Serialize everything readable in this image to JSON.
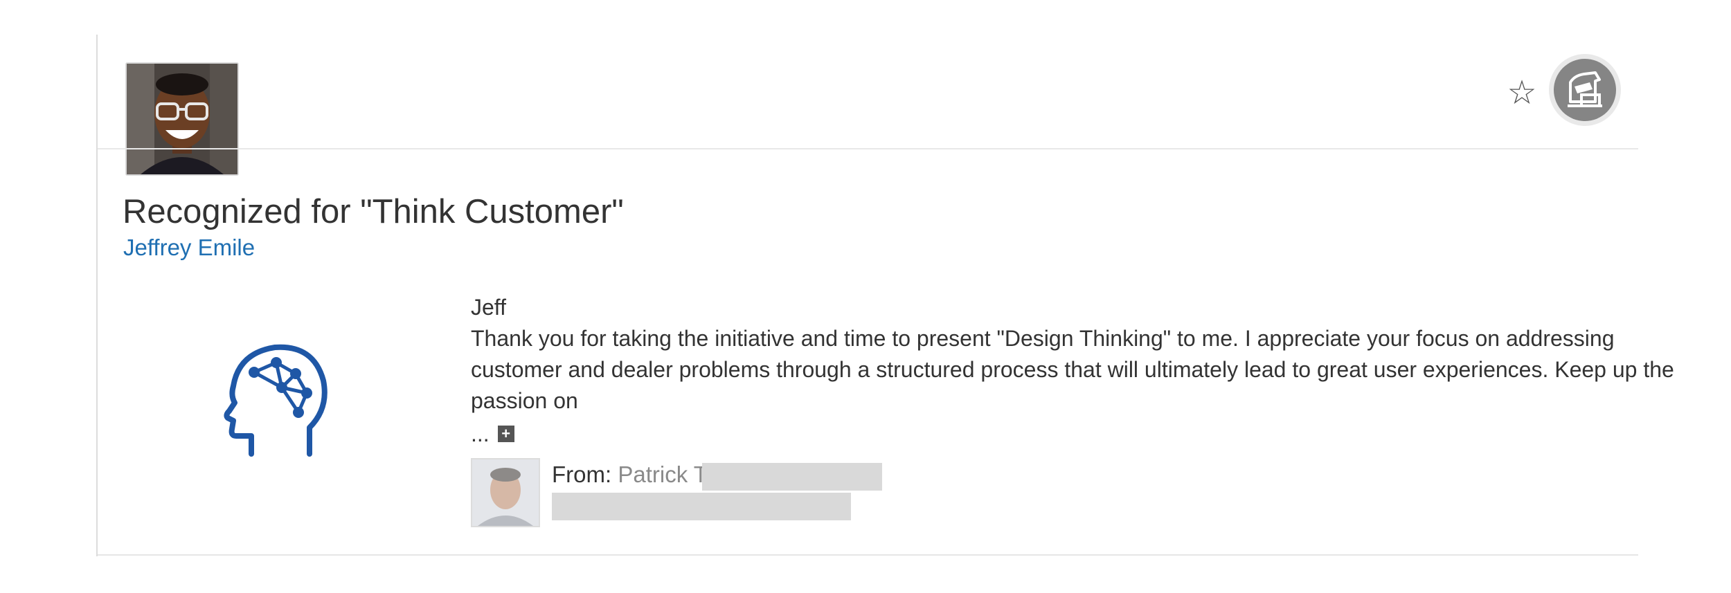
{
  "recognition": {
    "title": "Recognized for \"Think Customer\"",
    "recipient_name": "Jeffrey Emile",
    "value_icon": "brain-network-icon",
    "accent_color": "#1f57a6",
    "link_color": "#1f6fb2"
  },
  "header": {
    "favorite_icon": "star-outline-icon",
    "favorite_symbol": "☆",
    "badge_icon": "award-badge-icon"
  },
  "message": {
    "salutation": "Jeff",
    "body": "Thank you for taking the initiative and time to present \"Design Thinking\" to me. I appreciate your focus on addressing customer and dealer problems through a structured process that will ultimately lead to great user experiences. Keep up the passion on",
    "ellipsis": "...",
    "expand_symbol": "+"
  },
  "sender": {
    "from_label": "From:",
    "name": "Patrick T"
  }
}
